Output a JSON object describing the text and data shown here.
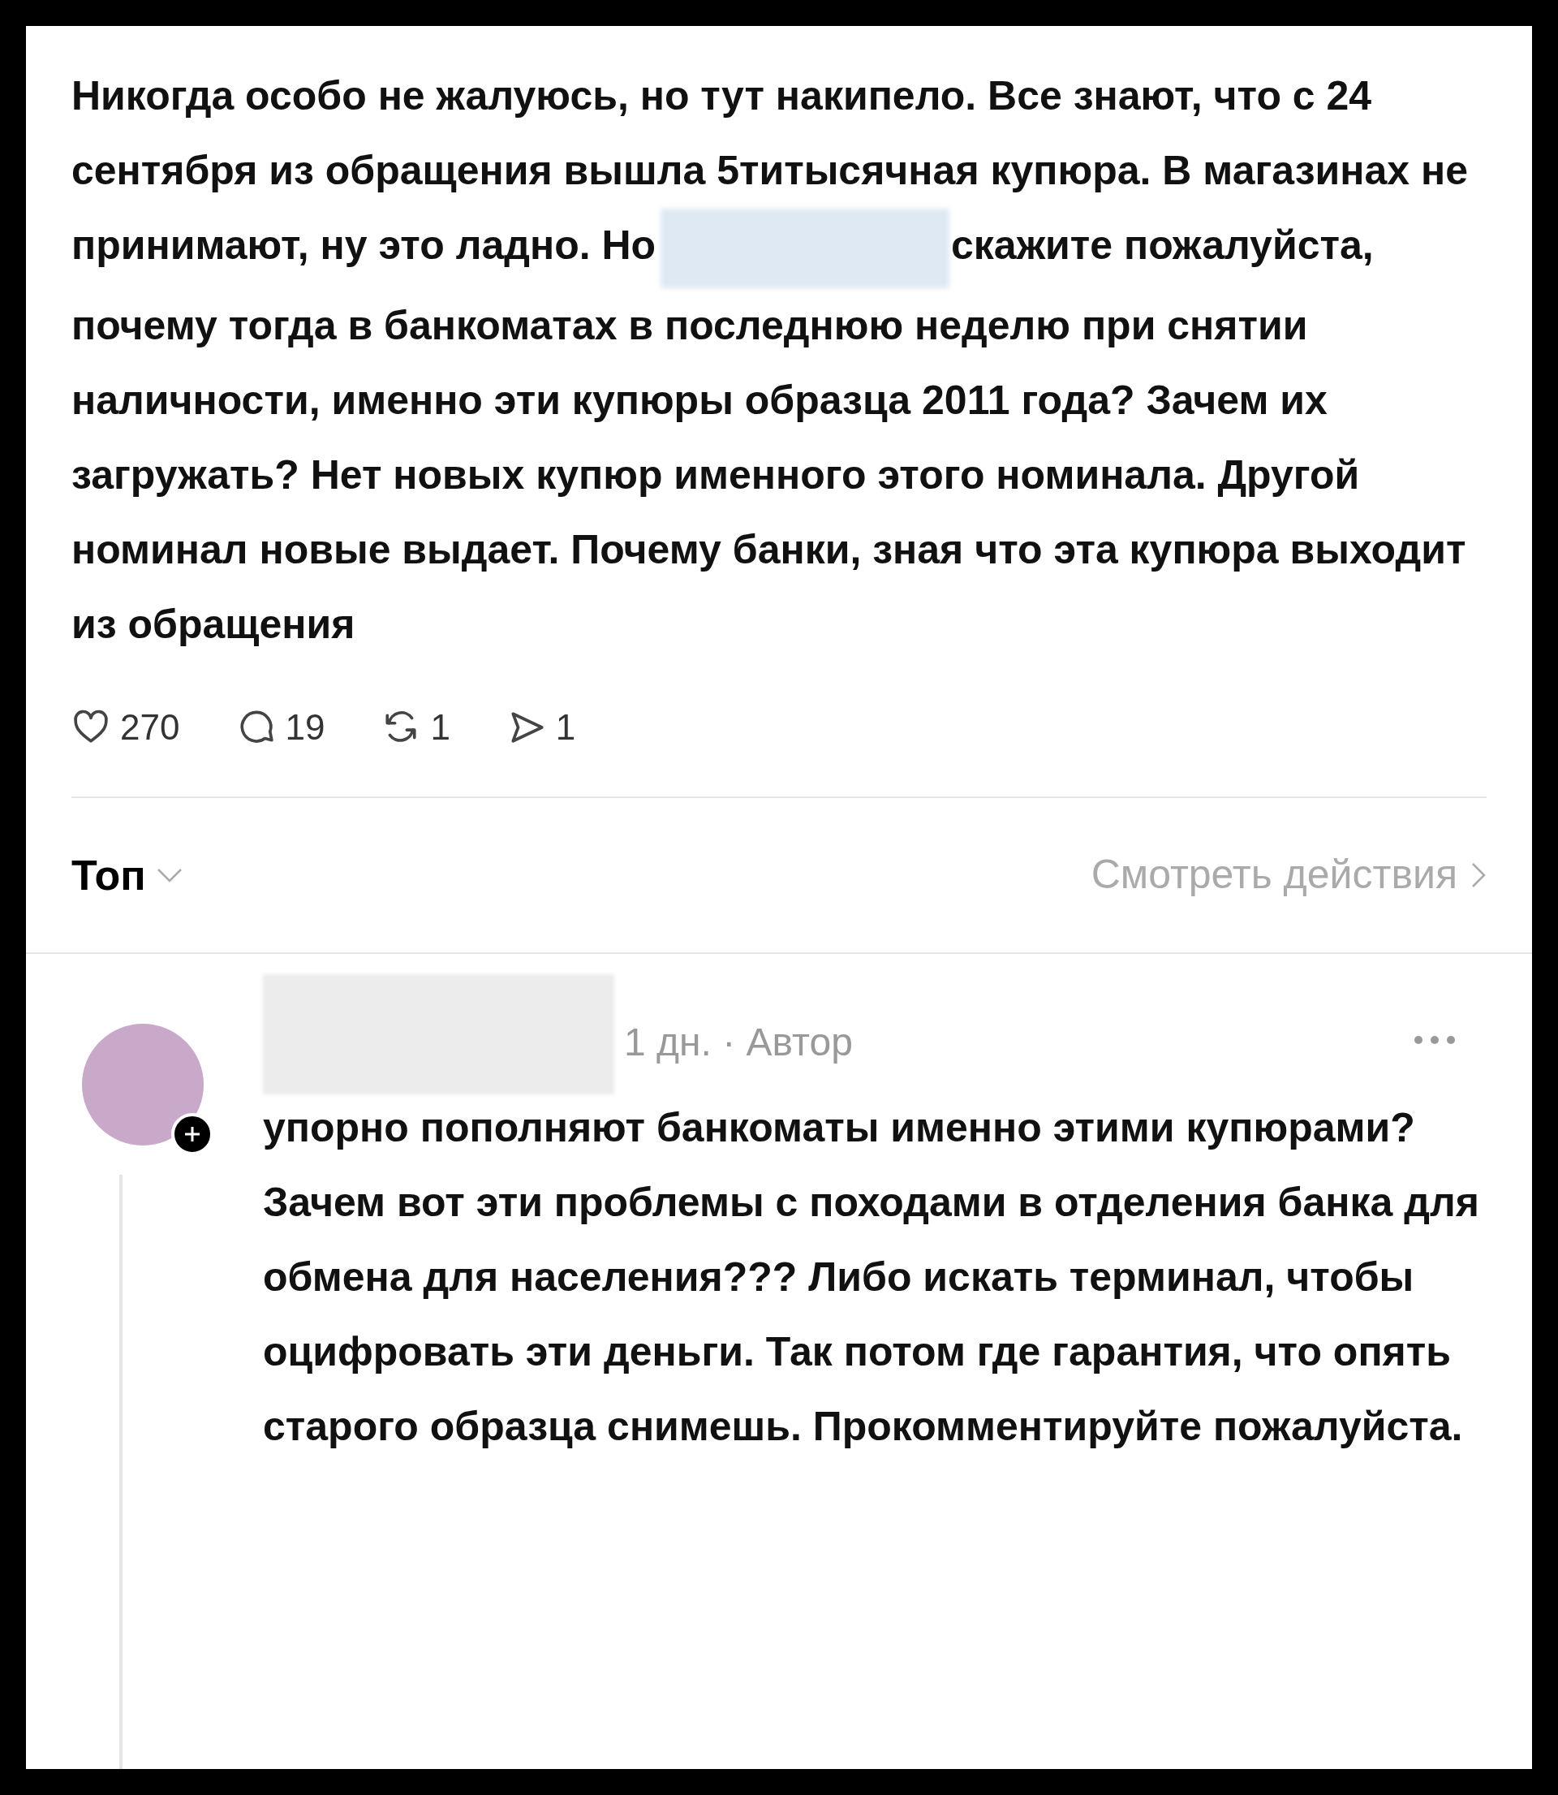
{
  "post": {
    "text_before": "Никогда особо не жалуюсь, но тут накипело. Все знают, что с 24 сентября из обращения вышла 5титысячная купюра. В магазинах не принимают, ну это ладно. Но",
    "text_after": "скажите пожалуйста, почему тогда в банкоматах в последнюю неделю при снятии наличности, именно эти купюры образца 2011 года? Зачем их загружать? Нет новых купюр именного этого номинала. Другой номинал новые выдает. Почему банки,  зная что эта купюра выходит из обращения",
    "actions": [
      {
        "kind": "like",
        "count": "270"
      },
      {
        "kind": "comment",
        "count": "19"
      },
      {
        "kind": "repost",
        "count": "1"
      },
      {
        "kind": "share",
        "count": "1"
      }
    ]
  },
  "sort": {
    "label": "Топ",
    "activity_link": "Смотреть действия"
  },
  "reply": {
    "meta": "1 дн. · Автор",
    "text": "упорно пополняют банкоматы именно этими купюрами? Зачем вот эти проблемы с походами в отделения банка для обмена для населения??? Либо искать терминал, чтобы оцифровать эти деньги. Так потом где гарантия, что опять старого образца снимешь. Прокомментируйте пожалуйста."
  }
}
